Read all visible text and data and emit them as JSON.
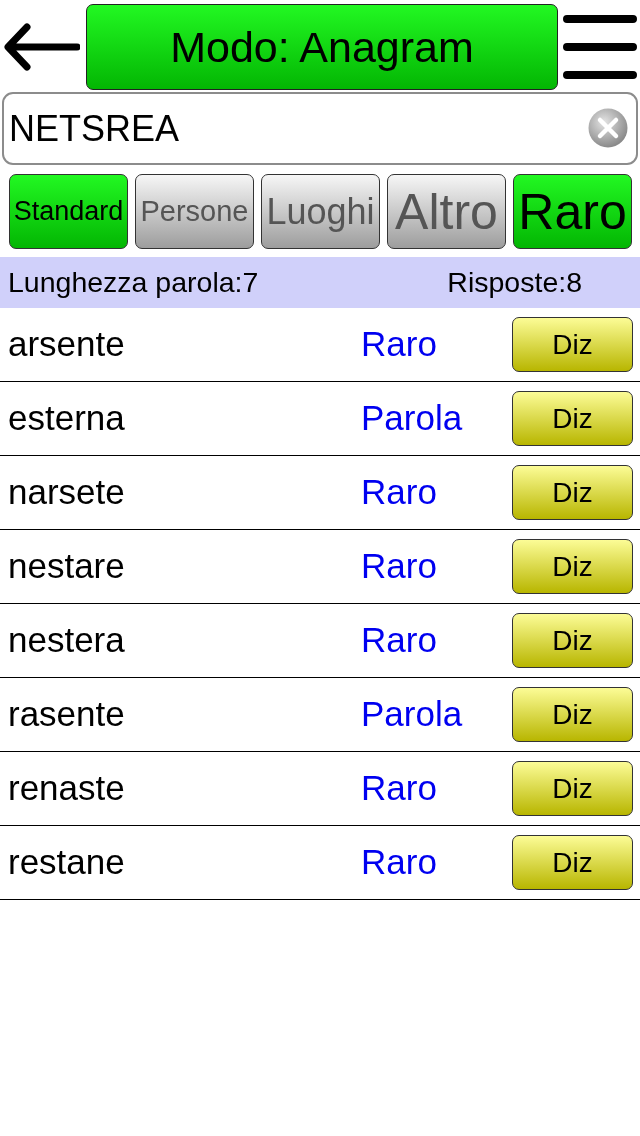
{
  "header": {
    "title": "Modo: Anagram"
  },
  "search": {
    "value": "NETSREA"
  },
  "filters": [
    {
      "label": "Standard",
      "selected": true
    },
    {
      "label": "Persone",
      "selected": false
    },
    {
      "label": "Luoghi",
      "selected": false
    },
    {
      "label": "Altro",
      "selected": false
    },
    {
      "label": "Raro",
      "selected": true
    }
  ],
  "info_bar": {
    "word_length": "Lunghezza parola:7",
    "answers": "Risposte:8"
  },
  "results": [
    {
      "word": "arsente",
      "type": "Raro",
      "button": "Diz"
    },
    {
      "word": "esterna",
      "type": "Parola",
      "button": "Diz"
    },
    {
      "word": "narsete",
      "type": "Raro",
      "button": "Diz"
    },
    {
      "word": "nestare",
      "type": "Raro",
      "button": "Diz"
    },
    {
      "word": "nestera",
      "type": "Raro",
      "button": "Diz"
    },
    {
      "word": "rasente",
      "type": "Parola",
      "button": "Diz"
    },
    {
      "word": "renaste",
      "type": "Raro",
      "button": "Diz"
    },
    {
      "word": "restane",
      "type": "Raro",
      "button": "Diz"
    }
  ]
}
